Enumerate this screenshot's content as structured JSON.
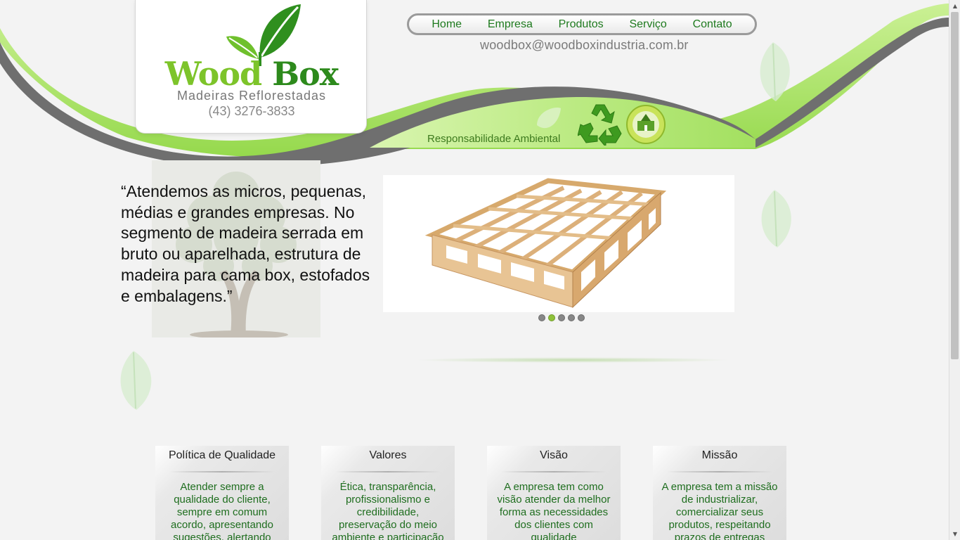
{
  "header": {
    "logo": {
      "name_part1": "Wood",
      "name_part2": "Box",
      "tagline": "Madeiras Reflorestadas",
      "phone": "(43) 3276-3833"
    },
    "nav": [
      {
        "label": "Home"
      },
      {
        "label": "Empresa"
      },
      {
        "label": "Produtos"
      },
      {
        "label": "Serviço"
      },
      {
        "label": "Contato"
      }
    ],
    "email": "woodbox@woodboxindustria.com.br",
    "responsibility": "Responsabilidade Ambiental"
  },
  "intro": {
    "quote": "“Atendemos as micros, pequenas, médias e grandes empresas. No segmento de madeira serrada em bruto ou aparelhada, estrutura de madeira para cama box, estofados e embalagens.”"
  },
  "slider": {
    "slide_count": 5,
    "active_index": 1
  },
  "boxes": [
    {
      "title": "Política de Qualidade",
      "text": "Atender sempre a qualidade do cliente, sempre em comum acordo, apresentando sugestões, alertando"
    },
    {
      "title": "Valores",
      "text": "Ética, transparência, profissionalismo e credibilidade, preservação do meio ambiente e participação"
    },
    {
      "title": "Visão",
      "text": "A empresa tem como visão atender da melhor forma as necessidades dos clientes com qualidade"
    },
    {
      "title": "Missão",
      "text": "A empresa tem a missão de industrializar, comercializar seus produtos, respeitando prazos de entregas"
    }
  ],
  "colors": {
    "accent_green": "#8fd13f",
    "dark_green": "#1e7a1e",
    "swoosh_gray": "#6f6f6f"
  }
}
